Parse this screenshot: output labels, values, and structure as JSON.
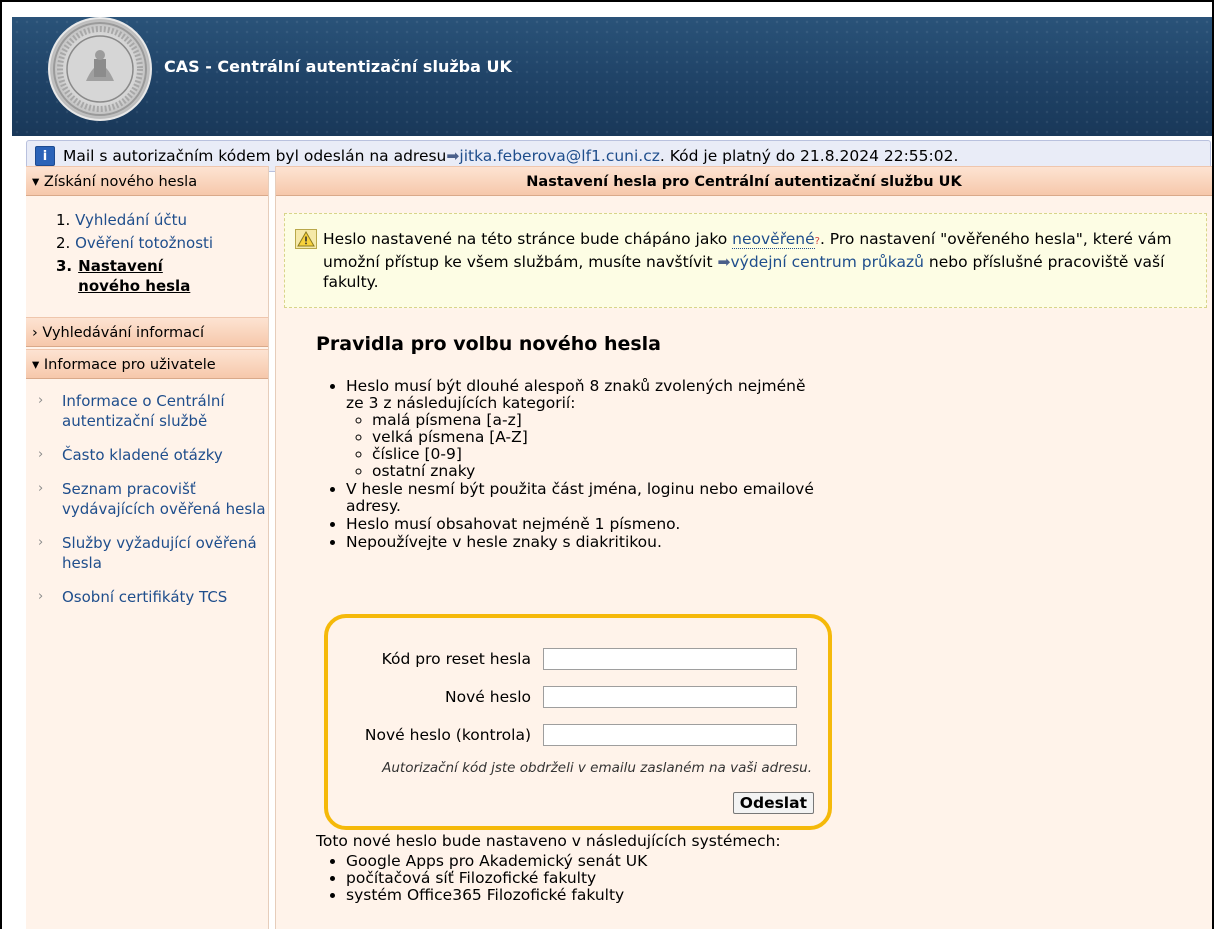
{
  "header": {
    "title": "CAS - Centrální autentizační služba UK"
  },
  "mailbar": {
    "prefix": "Mail s autorizačním kódem byl odeslán na adresu ",
    "email": "jitka.feberova@lf1.cuni.cz",
    "suffix": ". Kód je platný do 21.8.2024 22:55:02."
  },
  "sidebar": {
    "section1_title": "Získání nového hesla",
    "steps": [
      {
        "num": "1.",
        "label": "Vyhledání účtu"
      },
      {
        "num": "2.",
        "label": "Ověření totožnosti"
      },
      {
        "num": "3.",
        "label": "Nastavení nového hesla"
      }
    ],
    "section2_title": "Vyhledávání informací",
    "section3_title": "Informace pro uživatele",
    "info_links": [
      "Informace o Centrální autentizační službě",
      "Často kladené otázky",
      "Seznam pracovišť vydávajících ověřená hesla",
      "Služby vyžadující ověřená hesla",
      "Osobní certifikáty TCS"
    ]
  },
  "main": {
    "title": "Nastavení hesla pro Centrální autentizační službu UK",
    "warning": {
      "text1": "Heslo nastavené na této stránce bude chápáno jako ",
      "term": "neověřené",
      "q": "?",
      "text2": ". Pro nastavení \"ověřeného hesla\", které vám umožní přístup ke všem službám, musíte navštívit ",
      "link": "výdejní centrum průkazů",
      "text3": " nebo příslušné pracoviště vaší fakulty."
    },
    "rules_title": "Pravidla pro volbu nového hesla",
    "rule1": "Heslo musí být dlouhé alespoň 8 znaků zvolených nejméně ze 3 z následujících kategorií:",
    "categories": [
      "malá písmena [a-z]",
      "velká písmena [A-Z]",
      "číslice [0-9]",
      "ostatní znaky"
    ],
    "rule2": "V hesle nesmí být použita část jména, loginu nebo emailové adresy.",
    "rule3": "Heslo musí obsahovat nejméně 1 písmeno.",
    "rule4": "Nepoužívejte v hesle znaky s diakritikou.",
    "form": {
      "code_label": "Kód pro reset hesla",
      "new_label": "Nové heslo",
      "confirm_label": "Nové heslo (kontrola)",
      "note": "Autorizační kód jste obdrželi v emailu zaslaném na vaši adresu.",
      "submit": "Odeslat"
    },
    "systems_title": "Toto nové heslo bude nastaveno v následujících systémech:",
    "systems": [
      "Google Apps pro Akademický senát UK",
      "počítačová síť Filozofické fakulty",
      "systém Office365 Filozofické fakulty"
    ]
  }
}
